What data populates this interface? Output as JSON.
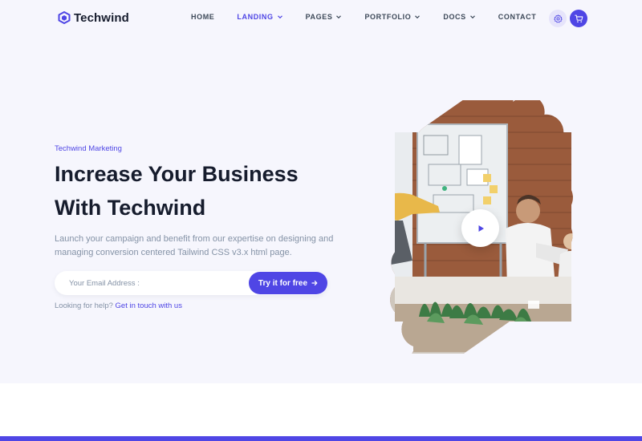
{
  "brand": {
    "name": "Techwind",
    "accent": "#4f46e5"
  },
  "nav": {
    "items": [
      {
        "label": "Home",
        "dropdown": false,
        "active": false
      },
      {
        "label": "Landing",
        "dropdown": true,
        "active": true
      },
      {
        "label": "Pages",
        "dropdown": true,
        "active": false
      },
      {
        "label": "Portfolio",
        "dropdown": true,
        "active": false
      },
      {
        "label": "Docs",
        "dropdown": true,
        "active": false
      },
      {
        "label": "Contact",
        "dropdown": false,
        "active": false
      }
    ],
    "actions": [
      {
        "icon": "gear-icon"
      },
      {
        "icon": "cart-icon"
      }
    ]
  },
  "hero": {
    "eyebrow": "Techwind Marketing",
    "title_line1": "Increase Your Business",
    "title_line2": "With Techwind",
    "description": "Launch your campaign and benefit from our expertise on designing and managing conversion centered Tailwind CSS v3.x html page.",
    "email_placeholder": "Your Email Address :",
    "cta_label": "Try it for free",
    "help_text": "Looking for help?",
    "help_link": "Get in touch with us",
    "media": {
      "icon": "play-icon"
    }
  }
}
